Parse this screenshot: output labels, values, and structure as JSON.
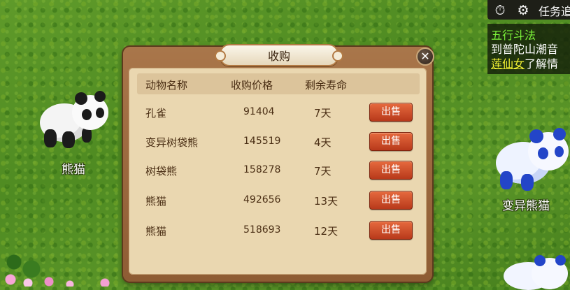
{
  "hud": {
    "timer_icon": "stopwatch-icon",
    "settings_icon": "gear-icon",
    "title": "任务追"
  },
  "quest": {
    "line1": "五行斗法",
    "line2": "到普陀山潮音",
    "line3_highlight": "莲仙女",
    "line3_rest": "了解情"
  },
  "scene": {
    "left_animal_label": "熊猫",
    "right_animal_label": "变异熊猫"
  },
  "dialog": {
    "title": "收购",
    "close_label": "✕",
    "headers": {
      "name": "动物名称",
      "price": "收购价格",
      "life": "剩余寿命"
    },
    "sell_label": "出售",
    "rows": [
      {
        "name": "孔雀",
        "price": "91404",
        "life": "7天"
      },
      {
        "name": "变异树袋熊",
        "price": "145519",
        "life": "4天"
      },
      {
        "name": "树袋熊",
        "price": "158278",
        "life": "7天"
      },
      {
        "name": "熊猫",
        "price": "492656",
        "life": "13天"
      },
      {
        "name": "熊猫",
        "price": "518693",
        "life": "12天"
      }
    ]
  },
  "colors": {
    "sell_button": "#c94a26",
    "quest_title": "#7cf23a",
    "quest_highlight": "#f3f233"
  }
}
